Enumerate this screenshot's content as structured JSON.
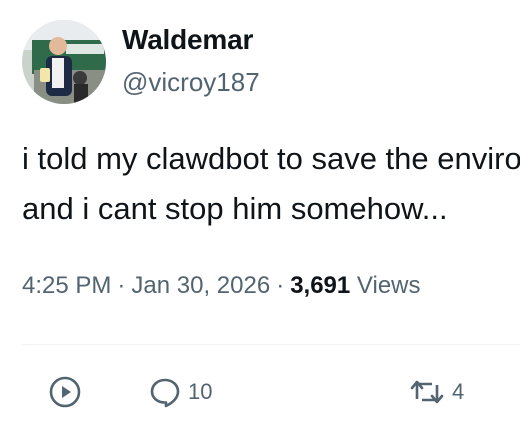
{
  "author": {
    "display_name": "Waldemar",
    "handle": "@vicroy187"
  },
  "tweet": {
    "lines": [
      "i told my clawdbot to save the environment",
      "and i cant stop him somehow..."
    ]
  },
  "meta": {
    "time": "4:25 PM",
    "separator": "·",
    "date": "Jan 30, 2026",
    "views_count": "3,691",
    "views_label": "Views"
  },
  "actions": {
    "replies": "10",
    "retweets": "4"
  },
  "icons": {
    "play": "play-circle-icon",
    "reply": "reply-bubble-icon",
    "retweet": "retweet-icon"
  },
  "colors": {
    "primary_text": "#0f1419",
    "secondary_text": "#536471",
    "divider": "#eff3f4"
  }
}
